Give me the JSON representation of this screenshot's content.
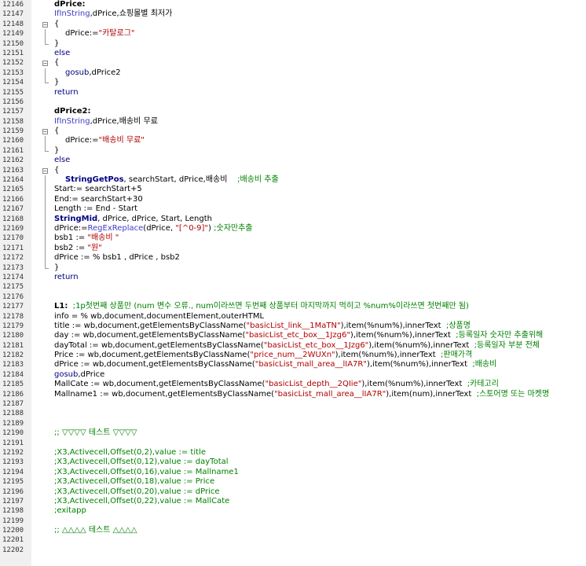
{
  "editor": {
    "lines": [
      {
        "n": "12146",
        "t": [
          [
            "lbl",
            "dPrice:"
          ]
        ]
      },
      {
        "n": "12147",
        "t": [
          [
            "fn",
            "IfInString"
          ],
          [
            "tx",
            ",dPrice,쇼핑몰별 최저가"
          ]
        ]
      },
      {
        "n": "12148",
        "t": [
          [
            "tx",
            "{"
          ]
        ],
        "fold": "start"
      },
      {
        "n": "12149",
        "i": 1,
        "t": [
          [
            "tx",
            "dPrice:="
          ],
          [
            "str",
            "\"카탈로그\""
          ]
        ],
        "fold": "mid"
      },
      {
        "n": "12150",
        "t": [
          [
            "tx",
            "}"
          ]
        ],
        "fold": "end"
      },
      {
        "n": "12151",
        "t": [
          [
            "kw",
            "else"
          ]
        ]
      },
      {
        "n": "12152",
        "t": [
          [
            "tx",
            "{"
          ]
        ],
        "fold": "start"
      },
      {
        "n": "12153",
        "i": 1,
        "t": [
          [
            "kw",
            "gosub"
          ],
          [
            "tx",
            ",dPrice2"
          ]
        ],
        "fold": "mid"
      },
      {
        "n": "12154",
        "t": [
          [
            "tx",
            "}"
          ]
        ],
        "fold": "end"
      },
      {
        "n": "12155",
        "t": [
          [
            "kw",
            "return"
          ]
        ]
      },
      {
        "n": "12156",
        "t": []
      },
      {
        "n": "12157",
        "t": [
          [
            "lbl",
            "dPrice2:"
          ]
        ]
      },
      {
        "n": "12158",
        "t": [
          [
            "fn",
            "IfInString"
          ],
          [
            "tx",
            ",dPrice,배송비 무료"
          ]
        ]
      },
      {
        "n": "12159",
        "t": [
          [
            "tx",
            "{"
          ]
        ],
        "fold": "start"
      },
      {
        "n": "12160",
        "i": 1,
        "t": [
          [
            "tx",
            "dPrice:="
          ],
          [
            "str",
            "\"배송비 무료\""
          ]
        ],
        "fold": "mid"
      },
      {
        "n": "12161",
        "t": [
          [
            "tx",
            "}"
          ]
        ],
        "fold": "end"
      },
      {
        "n": "12162",
        "t": [
          [
            "kw",
            "else"
          ]
        ]
      },
      {
        "n": "12163",
        "t": [
          [
            "tx",
            "{"
          ]
        ],
        "fold": "start"
      },
      {
        "n": "12164",
        "i": 1,
        "t": [
          [
            "kwb",
            "StringGetPos"
          ],
          [
            "tx",
            ", searchStart, dPrice,배송비    "
          ],
          [
            "cmt",
            ";배송비 추출"
          ]
        ],
        "fold": "mid"
      },
      {
        "n": "12165",
        "t": [
          [
            "tx",
            "Start:= searchStart+5"
          ]
        ],
        "fold": "mid"
      },
      {
        "n": "12166",
        "t": [
          [
            "tx",
            "End:= searchStart+30"
          ]
        ],
        "fold": "mid"
      },
      {
        "n": "12167",
        "t": [
          [
            "tx",
            "Length := End - Start"
          ]
        ],
        "fold": "mid"
      },
      {
        "n": "12168",
        "t": [
          [
            "kwb",
            "StringMid"
          ],
          [
            "tx",
            ", dPrice, dPrice, Start, Length"
          ]
        ],
        "fold": "mid"
      },
      {
        "n": "12169",
        "t": [
          [
            "tx",
            "dPrice:="
          ],
          [
            "fn",
            "RegExReplace"
          ],
          [
            "tx",
            "(dPrice, "
          ],
          [
            "str",
            "\"[^0-9]\""
          ],
          [
            "tx",
            ") "
          ],
          [
            "cmt",
            ";숫자만추출"
          ]
        ],
        "fold": "mid"
      },
      {
        "n": "12170",
        "t": [
          [
            "tx",
            "bsb1 := "
          ],
          [
            "str",
            "\"배송비 \""
          ]
        ],
        "fold": "mid"
      },
      {
        "n": "12171",
        "t": [
          [
            "tx",
            "bsb2 := "
          ],
          [
            "str",
            "\"원\""
          ]
        ],
        "fold": "mid"
      },
      {
        "n": "12172",
        "t": [
          [
            "tx",
            "dPrice := % bsb1 , dPrice , bsb2"
          ]
        ],
        "fold": "mid"
      },
      {
        "n": "12173",
        "t": [
          [
            "tx",
            "}"
          ]
        ],
        "fold": "end"
      },
      {
        "n": "12174",
        "t": [
          [
            "kw",
            "return"
          ]
        ]
      },
      {
        "n": "12175",
        "t": []
      },
      {
        "n": "12176",
        "t": []
      },
      {
        "n": "12177",
        "t": [
          [
            "lbl",
            "L1:"
          ],
          [
            "cmt",
            "  ;1p첫번째 상품만 (num 변수 오류., num이라쓰면 두번째 상품부터 마지막까지 먹히고 %num%이라쓰면 첫번째만 됨)"
          ]
        ]
      },
      {
        "n": "12178",
        "t": [
          [
            "tx",
            "info = % wb,document,documentElement,outerHTML"
          ]
        ]
      },
      {
        "n": "12179",
        "t": [
          [
            "tx",
            "title := wb,document,getElementsByClassName("
          ],
          [
            "str",
            "\"basicList_link__1MaTN\""
          ],
          [
            "tx",
            "),item(%num%),innerText  "
          ],
          [
            "cmt",
            ";상품명"
          ]
        ]
      },
      {
        "n": "12180",
        "t": [
          [
            "tx",
            "day := wb,document,getElementsByClassName("
          ],
          [
            "str",
            "\"basicList_etc_box__1Jzg6\""
          ],
          [
            "tx",
            "),item(%num%),innerText  "
          ],
          [
            "cmt",
            ";등록일자 숫자만 추출위해"
          ]
        ]
      },
      {
        "n": "12181",
        "t": [
          [
            "tx",
            "dayTotal := wb,document,getElementsByClassName("
          ],
          [
            "str",
            "\"basicList_etc_box__1Jzg6\""
          ],
          [
            "tx",
            "),item(%num%),innerText  "
          ],
          [
            "cmt",
            ";등록일자 부분 전체"
          ]
        ]
      },
      {
        "n": "12182",
        "t": [
          [
            "tx",
            "Price := wb,document,getElementsByClassName("
          ],
          [
            "str",
            "\"price_num__2WUXn\""
          ],
          [
            "tx",
            "),item(%num%),innerText  "
          ],
          [
            "cmt",
            ";판매가격"
          ]
        ]
      },
      {
        "n": "12183",
        "t": [
          [
            "tx",
            "dPrice := wb,document,getElementsByClassName("
          ],
          [
            "str",
            "\"basicList_mall_area__lIA7R\""
          ],
          [
            "tx",
            "),item(%num%),innerText  "
          ],
          [
            "cmt",
            ";배송비"
          ]
        ]
      },
      {
        "n": "12184",
        "t": [
          [
            "kw",
            "gosub"
          ],
          [
            "tx",
            ",dPrice"
          ]
        ]
      },
      {
        "n": "12185",
        "t": [
          [
            "tx",
            "MallCate := wb,document,getElementsByClassName("
          ],
          [
            "str",
            "\"basicList_depth__2QIie\""
          ],
          [
            "tx",
            "),item(%num%),innerText  "
          ],
          [
            "cmt",
            ";카테고리"
          ]
        ]
      },
      {
        "n": "12186",
        "t": [
          [
            "tx",
            "Mallname1 := wb,document,getElementsByClassName("
          ],
          [
            "str",
            "\"basicList_mall_area__lIA7R\""
          ],
          [
            "tx",
            "),item(num),innerText  "
          ],
          [
            "cmt",
            ";스토어명 또는 마켓명"
          ]
        ]
      },
      {
        "n": "12187",
        "t": []
      },
      {
        "n": "12188",
        "t": []
      },
      {
        "n": "12189",
        "t": []
      },
      {
        "n": "12190",
        "t": [
          [
            "cmt",
            ";; ▽▽▽▽ 테스트 ▽▽▽▽"
          ]
        ]
      },
      {
        "n": "12191",
        "t": []
      },
      {
        "n": "12192",
        "t": [
          [
            "cmt",
            ";X3,Activecell,Offset(0,2),value := title"
          ]
        ]
      },
      {
        "n": "12193",
        "t": [
          [
            "cmt",
            ";X3,Activecell,Offset(0,12),value := dayTotal"
          ]
        ]
      },
      {
        "n": "12194",
        "t": [
          [
            "cmt",
            ";X3,Activecell,Offset(0,16),value := Mallname1"
          ]
        ]
      },
      {
        "n": "12195",
        "t": [
          [
            "cmt",
            ";X3,Activecell,Offset(0,18),value := Price"
          ]
        ]
      },
      {
        "n": "12196",
        "t": [
          [
            "cmt",
            ";X3,Activecell,Offset(0,20),value := dPrice"
          ]
        ]
      },
      {
        "n": "12197",
        "t": [
          [
            "cmt",
            ";X3,Activecell,Offset(0,22),value := MallCate"
          ]
        ]
      },
      {
        "n": "12198",
        "t": [
          [
            "cmt",
            ";exitapp"
          ]
        ]
      },
      {
        "n": "12199",
        "t": []
      },
      {
        "n": "12200",
        "t": [
          [
            "cmt",
            ";; △△△△ 테스트 △△△△"
          ]
        ]
      },
      {
        "n": "12201",
        "t": []
      },
      {
        "n": "12202",
        "t": []
      }
    ]
  }
}
